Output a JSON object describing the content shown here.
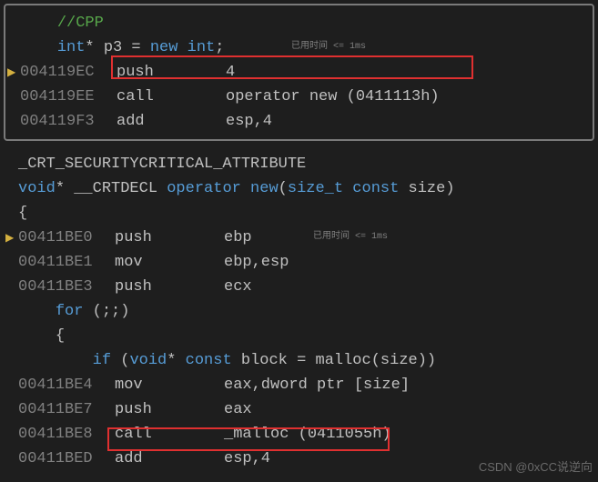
{
  "top_panel": {
    "src_indent": "    ",
    "src_comment": "//CPP",
    "src_decl_type": "int",
    "src_decl_star": "*",
    "src_decl_name": "p3",
    "src_decl_eq": " = ",
    "src_decl_new": "new",
    "src_decl_newtype": " int",
    "src_decl_semi": ";",
    "asm": [
      {
        "marker": "▶",
        "addr": "004119EC",
        "mn": "push",
        "op": "4"
      },
      {
        "marker": "",
        "addr": "004119EE",
        "mn": "call",
        "op": "operator new (0411113h)"
      },
      {
        "marker": "",
        "addr": "004119F3",
        "mn": "add",
        "op": "esp,4"
      }
    ]
  },
  "timing_label_1": "已用时间 <= 1ms",
  "bottom_panel": {
    "attr_macro": "_CRT_SECURITYCRITICAL_ATTRIBUTE",
    "decl_ret": "void",
    "decl_star": "*",
    "decl_call": " __CRTDECL ",
    "decl_op": "operator",
    "decl_new": " new",
    "decl_p1": "(",
    "decl_sizet": "size_t",
    "decl_const": " const ",
    "decl_param": "size",
    "decl_p2": ")",
    "brace_open": "{",
    "asm1": [
      {
        "marker": "▶",
        "addr": "00411BE0",
        "mn": "push",
        "op": "ebp"
      },
      {
        "marker": "",
        "addr": "00411BE1",
        "mn": "mov",
        "op": "ebp,esp"
      },
      {
        "marker": "",
        "addr": "00411BE3",
        "mn": "push",
        "op": "ecx"
      }
    ],
    "for_kw": "for",
    "for_rest": " (;;)",
    "inner_brace": "{",
    "if_kw": "if",
    "if_p1": " (",
    "if_void": "void",
    "if_star": "*",
    "if_const": " const ",
    "if_block": "block",
    "if_eq": " = ",
    "if_malloc": "malloc",
    "if_p2": "(",
    "if_size": "size",
    "if_p3": "))",
    "asm2": [
      {
        "marker": "",
        "addr": "00411BE4",
        "mn": "mov",
        "op": "eax,dword ptr [size]"
      },
      {
        "marker": "",
        "addr": "00411BE7",
        "mn": "push",
        "op": "eax"
      },
      {
        "marker": "",
        "addr": "00411BE8",
        "mn": "call",
        "op": "_malloc (0411055h)"
      },
      {
        "marker": "",
        "addr": "00411BED",
        "mn": "add",
        "op": "esp,4"
      }
    ]
  },
  "timing_label_2": "已用时间 <= 1ms",
  "watermark": "CSDN @0xCC说逆向"
}
